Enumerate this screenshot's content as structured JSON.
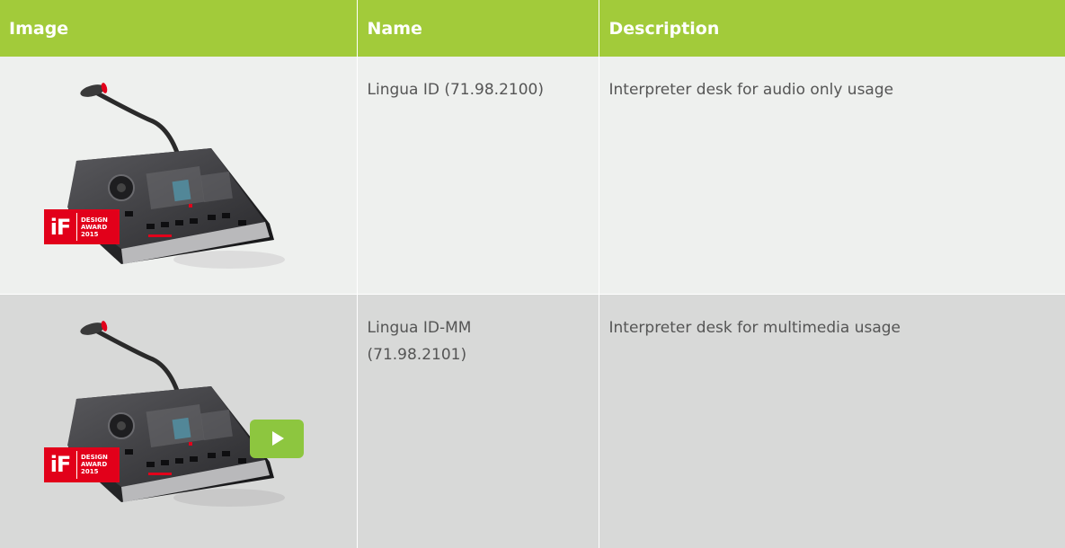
{
  "colors": {
    "header_bg": "#a2cb3a",
    "row_light": "#eef0ee",
    "row_dark": "#d8d9d8",
    "accent": "#8dc63f",
    "award_red": "#e2001a"
  },
  "table": {
    "headers": {
      "image": "Image",
      "name": "Name",
      "description": "Description"
    },
    "rows": [
      {
        "image_icon": "interpreter-desk-image",
        "badge": {
          "logo": "iF",
          "text": "DESIGN\nAWARD\n2015"
        },
        "has_play_button": false,
        "name": "Lingua ID (71.98.2100)",
        "description": "Interpreter desk for audio only usage"
      },
      {
        "image_icon": "interpreter-desk-image",
        "badge": {
          "logo": "iF",
          "text": "DESIGN\nAWARD\n2015"
        },
        "has_play_button": true,
        "play_icon": "play-icon",
        "name": "Lingua ID-MM\n(71.98.2101)",
        "description": "Interpreter desk for multimedia usage"
      }
    ]
  }
}
